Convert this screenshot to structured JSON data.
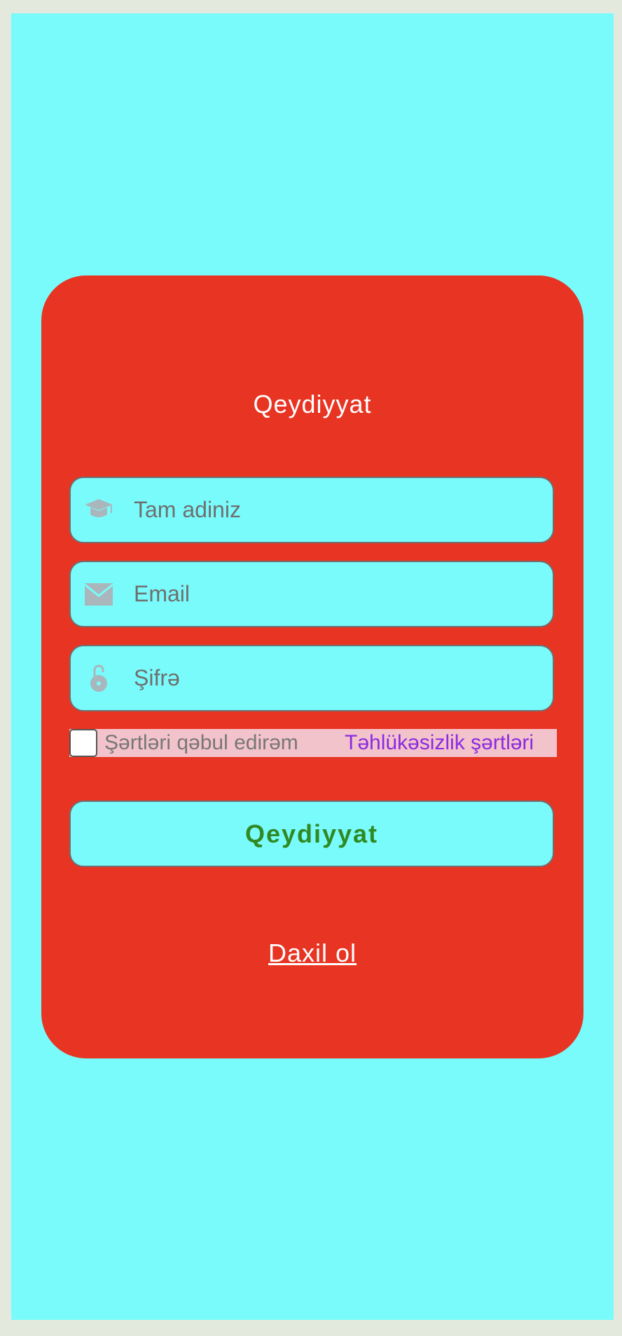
{
  "form": {
    "title": "Qeydiyyat",
    "fields": [
      {
        "placeholder": "Tam adiniz",
        "icon": "graduation-cap-icon"
      },
      {
        "placeholder": "Email",
        "icon": "envelope-icon"
      },
      {
        "placeholder": "Şifrə",
        "icon": "unlock-icon"
      }
    ],
    "terms": {
      "label": "Şərtləri qəbul edirəm",
      "link": "Təhlükəsizlik şərtləri",
      "checked": false
    },
    "submit_label": "Qeydiyyat",
    "login_link": "Daxil ol"
  },
  "colors": {
    "background": "#7afbfb",
    "card": "#e83423",
    "submit_text": "#2f8a23",
    "link": "#8b2be0",
    "terms_background": "#f3c3cb"
  }
}
